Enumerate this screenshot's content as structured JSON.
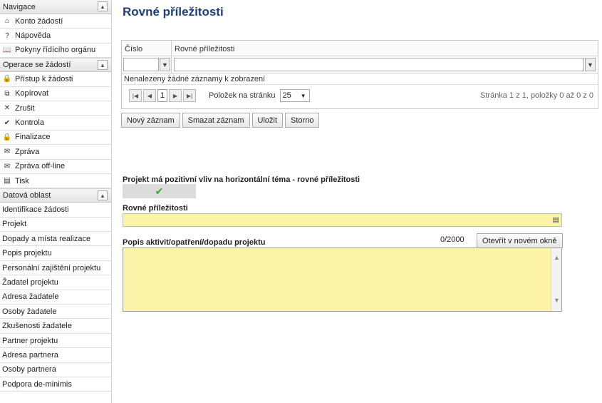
{
  "sidebar": {
    "nav_header": "Navigace",
    "nav_items": [
      {
        "icon": "home-icon",
        "glyph": "⌂",
        "label": "Konto žádostí"
      },
      {
        "icon": "help-icon",
        "glyph": "?",
        "label": "Nápověda"
      },
      {
        "icon": "book-icon",
        "glyph": "📖",
        "label": "Pokyny řídícího orgánu"
      }
    ],
    "ops_header": "Operace se žádostí",
    "ops_items": [
      {
        "icon": "lock-icon",
        "glyph": "🔒",
        "label": "Přístup k žádosti"
      },
      {
        "icon": "copy-icon",
        "glyph": "⧉",
        "label": "Kopírovat"
      },
      {
        "icon": "cancel-icon",
        "glyph": "✕",
        "label": "Zrušit"
      },
      {
        "icon": "check-icon",
        "glyph": "✔",
        "label": "Kontrola"
      },
      {
        "icon": "finalize-lock-icon",
        "glyph": "🔒",
        "label": "Finalizace"
      },
      {
        "icon": "message-icon",
        "glyph": "✉",
        "label": "Zpráva"
      },
      {
        "icon": "message-offline-icon",
        "glyph": "✉",
        "label": "Zpráva off-line"
      },
      {
        "icon": "print-icon",
        "glyph": "▤",
        "label": "Tisk"
      }
    ],
    "data_header": "Datová oblast",
    "data_items": [
      "Identifikace žádosti",
      "Projekt",
      "Dopady a místa realizace",
      "Popis projektu",
      "Personální zajištění projektu",
      "Žadatel projektu",
      "Adresa žadatele",
      "Osoby žadatele",
      "Zkušenosti žadatele",
      "Partner projektu",
      "Adresa partnera",
      "Osoby partnera",
      "Podpora de-minimis"
    ]
  },
  "main": {
    "title": "Rovné příležitosti",
    "grid": {
      "columns": [
        "Číslo",
        "Rovné příležitosti"
      ],
      "empty_message": "Nenalezeny žádné záznamy k zobrazení",
      "page": "1",
      "per_page_label": "Položek na stránku",
      "per_page_value": "25",
      "page_info": "Stránka 1 z 1, položky 0 až 0 z 0"
    },
    "buttons": {
      "new": "Nový záznam",
      "delete": "Smazat záznam",
      "save": "Uložit",
      "cancel": "Storno"
    },
    "positive_impact_label": "Projekt má pozitivní vliv na horizontální téma - rovné příležitosti",
    "rovne_label": "Rovné příležitosti",
    "popis_label": "Popis aktivit/opatření/dopadu projektu",
    "counter": "0/2000",
    "open_window": "Otevřít v novém okně"
  }
}
